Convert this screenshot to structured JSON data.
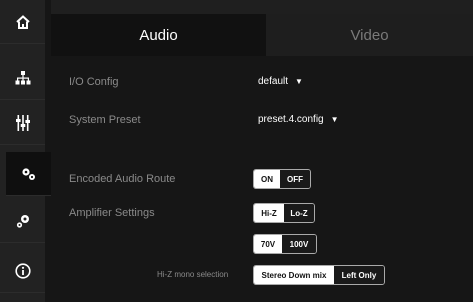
{
  "sidebar": {
    "items": [
      {
        "icon": "home-icon"
      },
      {
        "icon": "network-icon"
      },
      {
        "icon": "sliders-icon"
      },
      {
        "icon": "gears-icon",
        "active": true
      },
      {
        "icon": "settings-icon"
      },
      {
        "icon": "info-icon"
      }
    ]
  },
  "tabs": {
    "audio": "Audio",
    "video": "Video",
    "selected": "Audio"
  },
  "io_config": {
    "label": "I/O Config",
    "value": "default",
    "caret": "▼"
  },
  "system_preset": {
    "label": "System Preset",
    "value": "preset.4.config",
    "caret": "▼"
  },
  "encoded_audio_route": {
    "label": "Encoded Audio Route",
    "on": "ON",
    "off": "OFF",
    "selected": "ON"
  },
  "amplifier_settings": {
    "label": "Amplifier Settings",
    "impedance": {
      "hiz": "Hi-Z",
      "loz": "Lo-Z",
      "selected": "Hi-Z"
    },
    "voltage": {
      "v70": "70V",
      "v100": "100V",
      "selected": "70V"
    }
  },
  "hiz_mono": {
    "label": "Hi-Z mono selection",
    "stereo": "Stereo Down mix",
    "left": "Left Only",
    "selected": "Stereo Down mix"
  },
  "colors": {
    "accent": "#ffffff",
    "sidebar": "#222222",
    "content": "#161616"
  }
}
